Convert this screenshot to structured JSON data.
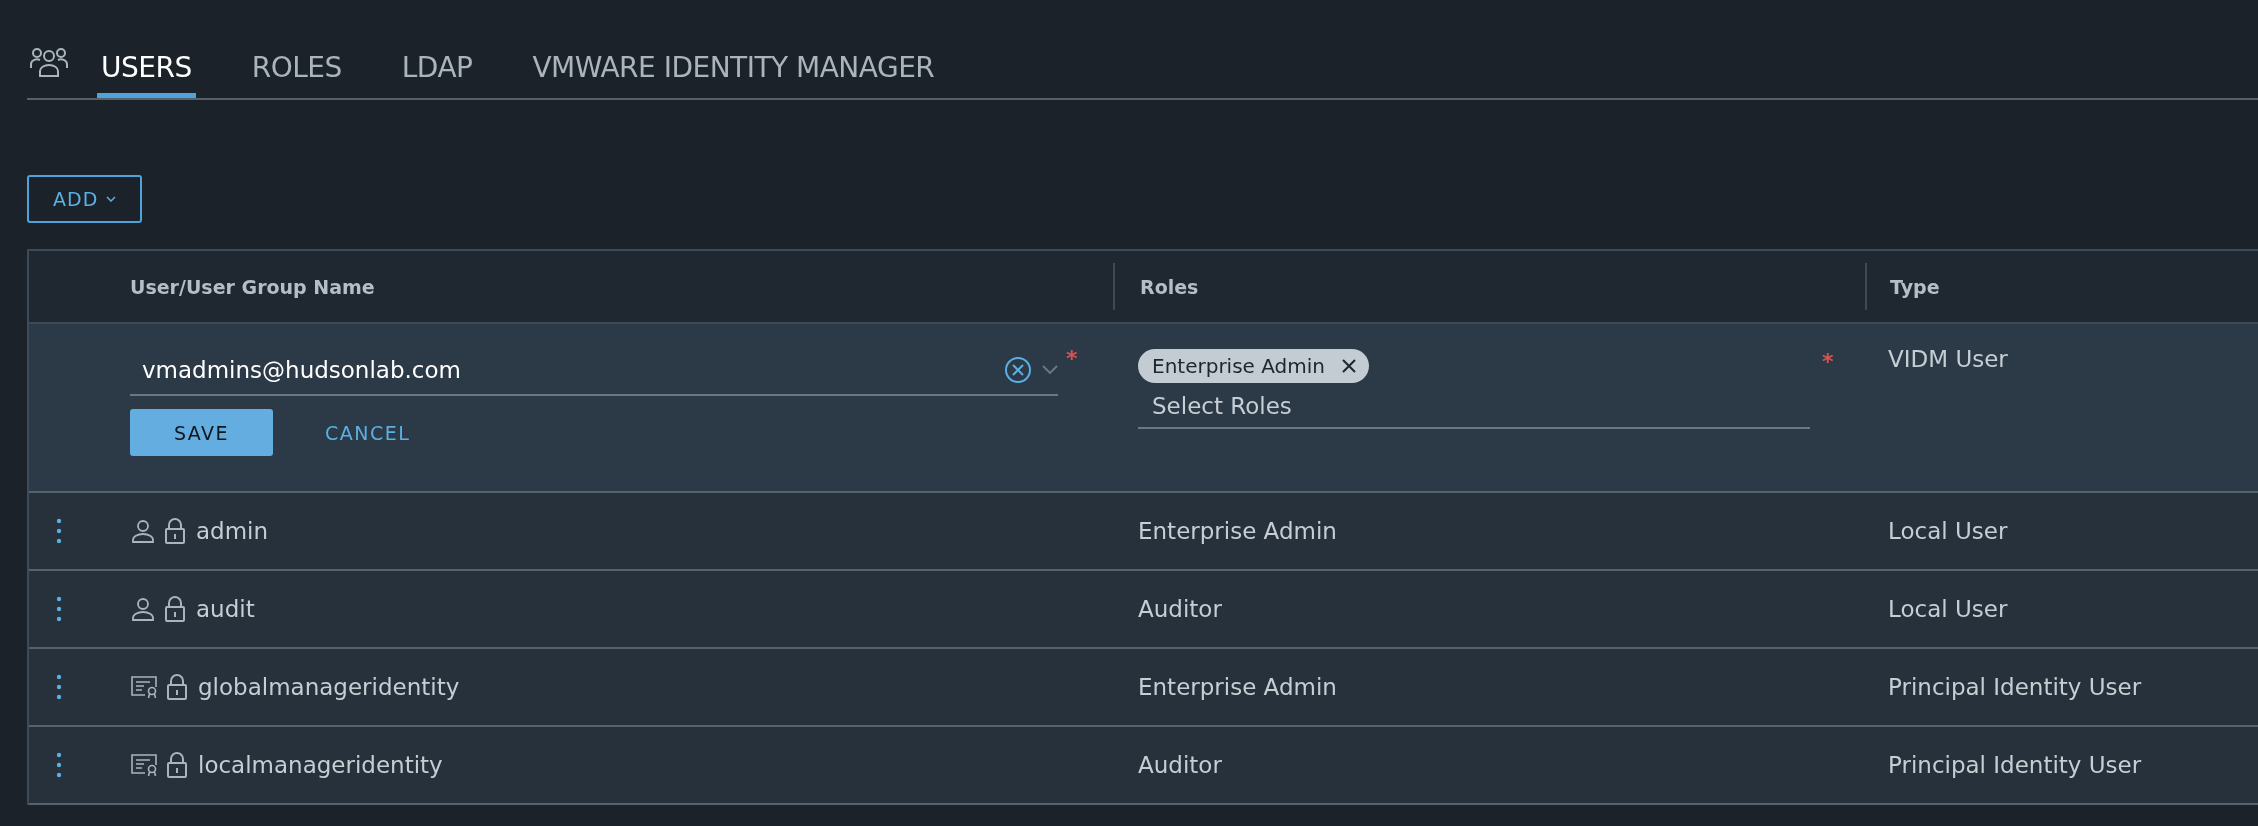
{
  "tabs": [
    {
      "label": "USERS",
      "selected": true
    },
    {
      "label": "ROLES",
      "selected": false
    },
    {
      "label": "LDAP",
      "selected": false
    },
    {
      "label": "VMWARE IDENTITY MANAGER",
      "selected": false
    }
  ],
  "add_button": {
    "label": "ADD"
  },
  "table": {
    "columns": [
      "User/User Group Name",
      "Roles",
      "Type"
    ],
    "edit_row": {
      "name_field": {
        "value": "vmadmins@hudsonlab.com",
        "required_mark": "*"
      },
      "save": "SAVE",
      "cancel": "CANCEL",
      "roles_field": {
        "chips": [
          "Enterprise Admin"
        ],
        "placeholder": "Select Roles",
        "required_mark": "*"
      },
      "type": "VIDM User"
    },
    "rows": [
      {
        "kind": "user",
        "name": "admin",
        "role": "Enterprise Admin",
        "type": "Local User"
      },
      {
        "kind": "user",
        "name": "audit",
        "role": "Auditor",
        "type": "Local User"
      },
      {
        "kind": "certificate",
        "name": "globalmanageridentity",
        "role": "Enterprise Admin",
        "type": "Principal Identity User"
      },
      {
        "kind": "certificate",
        "name": "localmanageridentity",
        "role": "Auditor",
        "type": "Principal Identity User"
      }
    ]
  }
}
